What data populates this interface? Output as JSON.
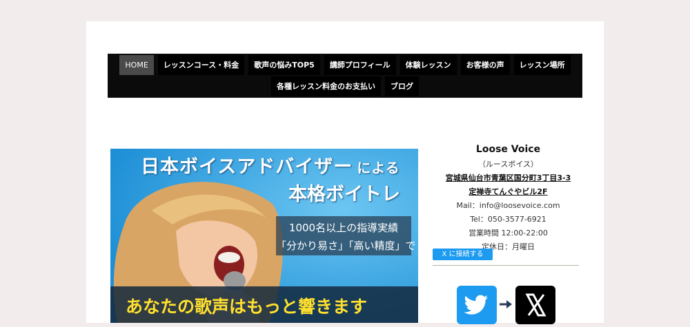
{
  "nav": {
    "items": [
      {
        "label": "HOME",
        "active": true
      },
      {
        "label": "レッスンコース・料金"
      },
      {
        "label": "歌声の悩みTOP5"
      },
      {
        "label": "講師プロフィール"
      },
      {
        "label": "体験レッスン"
      },
      {
        "label": "お客様の声"
      },
      {
        "label": "レッスン場所"
      },
      {
        "label": "各種レッスン料金のお支払い"
      },
      {
        "label": "ブログ"
      }
    ]
  },
  "hero": {
    "title_main": "日本ボイスアドバイザー",
    "title_particle": "による",
    "title_sub": "本格ボイトレ",
    "box_line1": "1000名以上の指導実績",
    "box_line2": "「分かり易さ」「高い精度」で",
    "band_text": "あなたの歌声はもっと響きます"
  },
  "sidebar": {
    "name": "Loose Voice",
    "kana": "（ルースボイス）",
    "address_line1": "宮城県仙台市青葉区国分町3丁目3-3",
    "address_line2": "定禅寺てんぐやビル2F",
    "mail": "Mail：info@loosevoice.com",
    "tel": "Tel：050-3577-6921",
    "hours": "営業時間 12:00-22:00",
    "holiday": "定休日：月曜日",
    "x_connect_label": "X に接続する"
  },
  "colors": {
    "page_bg": "#f2ecec",
    "nav_bg": "#0b0b0b",
    "nav_active": "#4a4a4a",
    "hero_bg": "#3aa9e6",
    "band_text": "#ffe02e",
    "twitter_blue": "#1d9bf0"
  }
}
